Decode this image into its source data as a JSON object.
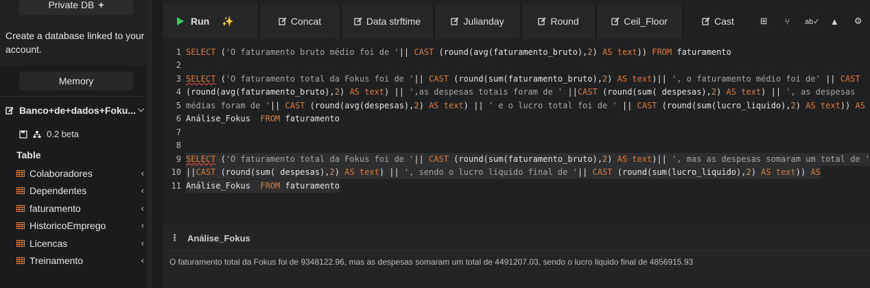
{
  "sidebar": {
    "private_label": "Private DB",
    "description": "Create a database linked to your account.",
    "memory_label": "Memory",
    "database_name": "Banco+de+dados+Foku...",
    "version": "0.2 beta",
    "table_heading": "Table",
    "tables": [
      {
        "label": "Colaboradores"
      },
      {
        "label": "Dependentes"
      },
      {
        "label": "faturamento"
      },
      {
        "label": "HistoricoEmprego"
      },
      {
        "label": "Licencas"
      },
      {
        "label": "Treinamento"
      }
    ]
  },
  "toolbar": {
    "run_label": "Run",
    "tabs": [
      {
        "label": "Concat"
      },
      {
        "label": "Data strftime"
      },
      {
        "label": "Julianday"
      },
      {
        "label": "Round"
      },
      {
        "label": "Ceil_Floor"
      },
      {
        "label": "Cast"
      }
    ],
    "active_tab": "Cast",
    "icons": [
      "add-icon",
      "share-icon",
      "spellcheck-icon",
      "user-icon",
      "settings-icon"
    ]
  },
  "editor": {
    "line_numbers": [
      "1",
      "2",
      "3",
      "4",
      "5",
      "6",
      "7",
      "8",
      "9",
      "10",
      "11"
    ]
  },
  "results": {
    "column_name": "Análise_Fokus",
    "value": "O faturamento total da Fokus foi de 9348122.96, mas as despesas somaram um total de 4491207.03, sendo o lucro liquido final de 4856915.93"
  },
  "colors": {
    "keyword": "#e07b3c",
    "string": "#a7a7a7",
    "run_green": "#3cc65a",
    "background": "#1f2021"
  }
}
